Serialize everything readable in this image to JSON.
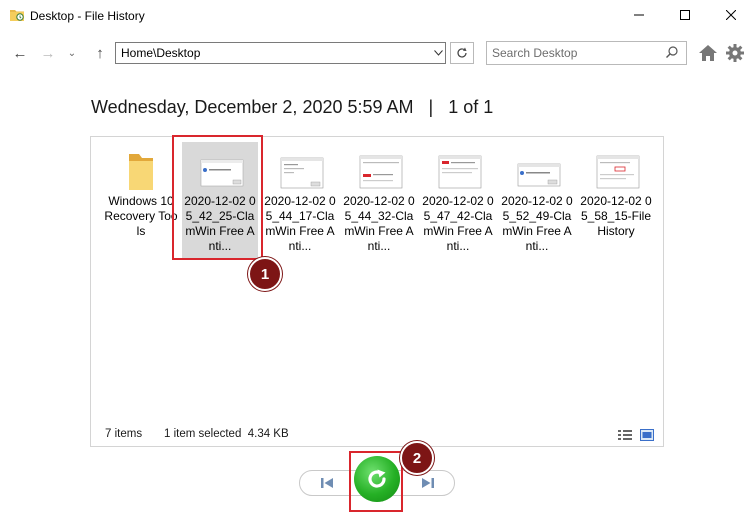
{
  "window": {
    "title": "Desktop - File History",
    "icon": "folder-history-icon"
  },
  "nav": {
    "address": "Home\\Desktop",
    "search_placeholder": "Search Desktop"
  },
  "header": {
    "date": "Wednesday, December 2, 2020 5:59 AM",
    "separator": "|",
    "page_indicator": "1 of 1"
  },
  "files": [
    {
      "label": "Windows 10 Recovery Tools",
      "type": "folder",
      "selected": false
    },
    {
      "label": "2020-12-02 05_42_25-ClamWin Free Anti...",
      "type": "image",
      "selected": true
    },
    {
      "label": "2020-12-02 05_44_17-ClamWin Free Anti...",
      "type": "image",
      "selected": false
    },
    {
      "label": "2020-12-02 05_44_32-ClamWin Free Anti...",
      "type": "image",
      "selected": false
    },
    {
      "label": "2020-12-02 05_47_42-ClamWin Free Anti...",
      "type": "image",
      "selected": false
    },
    {
      "label": "2020-12-02 05_52_49-ClamWin Free Anti...",
      "type": "image",
      "selected": false
    },
    {
      "label": "2020-12-02 05_58_15-File History",
      "type": "image",
      "selected": false
    }
  ],
  "status": {
    "item_count": "7 items",
    "selection": "1 item selected  4.34 KB"
  },
  "annotations": {
    "badge1": "1",
    "badge2": "2"
  },
  "colors": {
    "highlight": "#d9262d",
    "badge": "#7d1515",
    "restore": "#25b025"
  }
}
